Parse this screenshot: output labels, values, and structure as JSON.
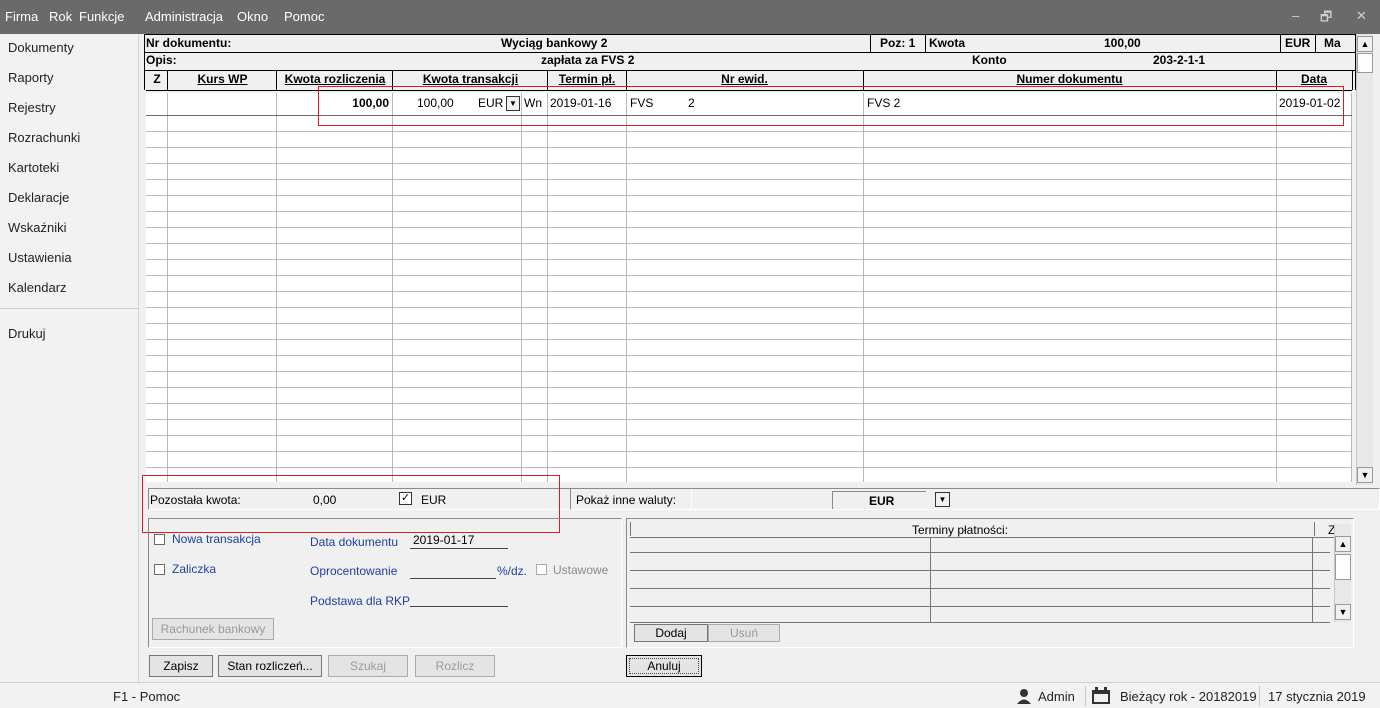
{
  "menu": [
    "Firma",
    "Rok",
    "Funkcje",
    "Administracja",
    "Okno",
    "Pomoc"
  ],
  "window_controls": [
    "–",
    "🗗",
    "✕"
  ],
  "sidebar": {
    "items": [
      "Dokumenty",
      "Raporty",
      "Rejestry",
      "Rozrachunki",
      "Kartoteki",
      "Deklaracje",
      "Wskaźniki",
      "Ustawienia",
      "Kalendarz",
      "Drukuj"
    ]
  },
  "header": {
    "nr_label": "Nr dokumentu:",
    "nr_value": "Wyciąg bankowy 2",
    "poz_label": "Poz: 1",
    "kwota_label": "Kwota",
    "kwota_value": "100,00",
    "currency": "EUR",
    "ma": "Ma",
    "opis_label": "Opis:",
    "opis_value": "zapłata za FVS 2",
    "konto_label": "Konto",
    "konto_value": "203-2-1-1"
  },
  "columns": [
    "Z",
    "Kurs WP",
    "Kwota rozliczenia",
    "Kwota transakcji",
    "Termin pł.",
    "Nr ewid.",
    "Numer dokumentu",
    "Data"
  ],
  "rows": [
    {
      "kwota_rozliczenia": "100,00",
      "kwota_transakcji": "100,00",
      "waluta": "EUR",
      "strona": "Wn",
      "termin": "2019-01-16",
      "nr_ewid_prefix": "FVS",
      "nr_ewid_num": "2",
      "numer_dokumentu": "FVS 2",
      "data": "2019-01-02"
    }
  ],
  "summary": {
    "pozostala_label": "Pozostała kwota:",
    "pozostala_value": "0,00",
    "eur_checkbox_label": "EUR",
    "pokaz_label": "Pokaż inne waluty:",
    "pokaz_value": "EUR"
  },
  "form": {
    "nowa_transakcja": "Nowa transakcja",
    "zaliczka": "Zaliczka",
    "data_dokumentu_label": "Data dokumentu",
    "data_dokumentu_value": "2019-01-17",
    "oprocentowanie_label": "Oprocentowanie",
    "oprocentowanie_unit": "%/dz.",
    "ustawowe": "Ustawowe",
    "podstawa_label": "Podstawa dla RKP",
    "rachunek_button": "Rachunek bankowy"
  },
  "terminy": {
    "title": "Terminy płatności:",
    "z": "Z",
    "dodaj": "Dodaj",
    "usun": "Usuń"
  },
  "buttons": {
    "zapisz": "Zapisz",
    "stan": "Stan rozliczeń...",
    "szukaj": "Szukaj",
    "rozlicz": "Rozlicz",
    "anuluj": "Anuluj"
  },
  "status": {
    "help": "F1 - Pomoc",
    "user": "Admin",
    "rok": "Bieżący rok - 20182019",
    "date": "17 stycznia 2019"
  },
  "colors": {
    "menubar": "#6a6a6a",
    "highlight_red": "#d42020",
    "label_blue": "#1f3fa0"
  }
}
